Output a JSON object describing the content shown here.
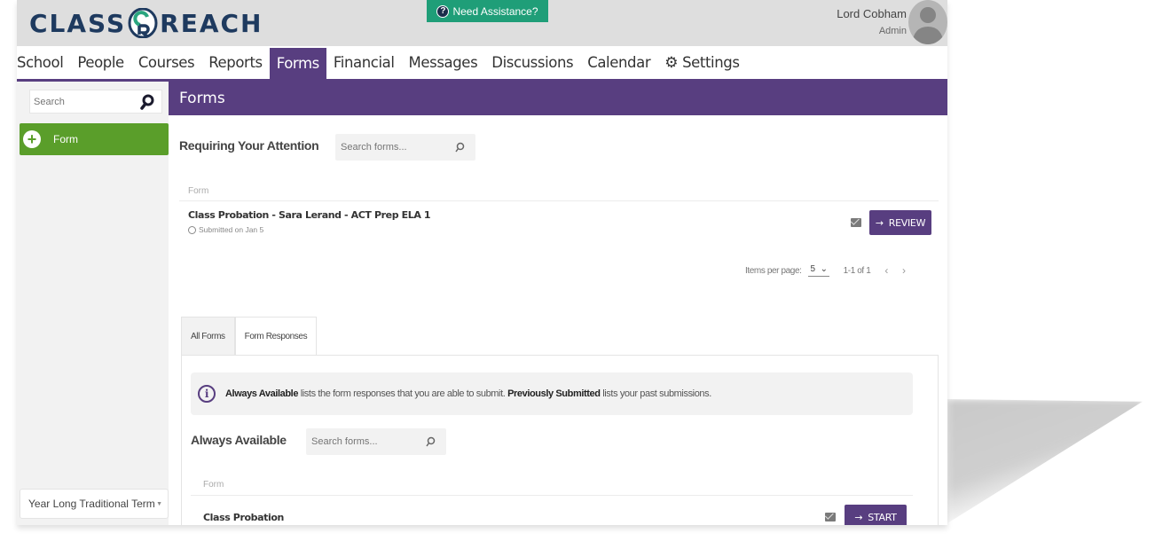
{
  "header": {
    "logo_left": "CLASS",
    "logo_right": "REACH",
    "help_label": "Need Assistance?",
    "user_name": "Lord Cobham",
    "user_role": "Admin"
  },
  "nav": {
    "items": [
      {
        "label": "School"
      },
      {
        "label": "People"
      },
      {
        "label": "Courses"
      },
      {
        "label": "Reports"
      },
      {
        "label": "Forms",
        "active": true
      },
      {
        "label": "Financial"
      },
      {
        "label": "Messages"
      },
      {
        "label": "Discussions"
      },
      {
        "label": "Calendar"
      },
      {
        "label": "Settings",
        "icon": "gear-icon"
      }
    ]
  },
  "sidebar": {
    "search_placeholder": "Search",
    "add_button_label": "Form",
    "term_selected": "Year Long Traditional Term"
  },
  "main": {
    "page_title": "Forms",
    "requiring": {
      "title": "Requiring Your Attention",
      "search_placeholder": "Search forms...",
      "column_header": "Form",
      "rows": [
        {
          "title": "Class Probation - Sara Lerand - ACT Prep ELA 1",
          "subtitle": "Submitted on Jan 5",
          "action_label": "REVIEW"
        }
      ],
      "pager": {
        "items_per_page_label": "Items per page:",
        "items_per_page_value": "5",
        "range": "1-1 of 1"
      }
    },
    "tabs": [
      {
        "label": "All Forms",
        "active": false
      },
      {
        "label": "Form Responses",
        "active": true
      }
    ],
    "info": {
      "bold1": "Always Available",
      "text1": " lists the form responses that you are able to submit. ",
      "bold2": "Previously Submitted",
      "text2": " lists your past submissions."
    },
    "always_available": {
      "title": "Always Available",
      "search_placeholder": "Search forms...",
      "column_header": "Form",
      "rows": [
        {
          "title": "Class Probation",
          "action_label": "START"
        }
      ]
    }
  },
  "colors": {
    "brand_purple": "#583e80",
    "help_green": "#1f9e78",
    "add_green": "#5a9e2a",
    "logo_navy": "#1e3a5f"
  }
}
